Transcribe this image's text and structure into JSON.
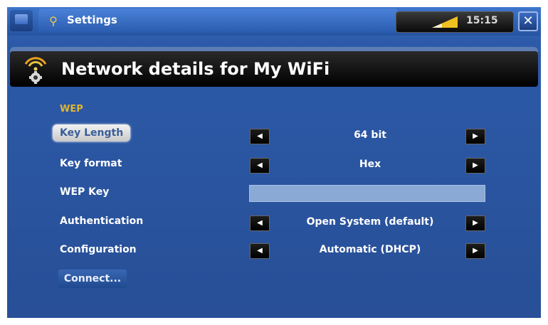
{
  "topbar": {
    "app_title": "Settings",
    "clock": "15:15",
    "close_glyph": "✕"
  },
  "header": {
    "title": "Network details for My WiFi"
  },
  "section": {
    "label": "WEP"
  },
  "rows": [
    {
      "label": "Key Length",
      "value": "64 bit"
    },
    {
      "label": "Key format",
      "value": "Hex"
    },
    {
      "label": "WEP Key",
      "value": ""
    },
    {
      "label": "Authentication",
      "value": "Open System (default)"
    },
    {
      "label": "Configuration",
      "value": "Automatic (DHCP)"
    }
  ],
  "connect_label": "Connect...",
  "icons": {
    "left": "arrow-left-icon",
    "right": "arrow-right-icon",
    "wifi": "wifi-gear-icon"
  },
  "colors": {
    "accent_yellow": "#e0b530",
    "background_blue": "#2c5aa8"
  }
}
